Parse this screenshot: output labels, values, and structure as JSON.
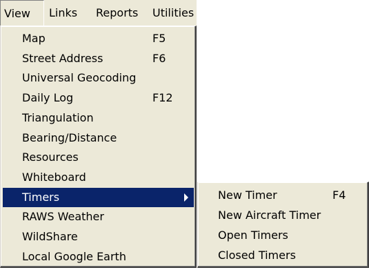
{
  "menubar": {
    "items": [
      "View",
      "Links",
      "Reports",
      "Utilities"
    ]
  },
  "view_menu": {
    "items": [
      {
        "label": "Map",
        "shortcut": "F5"
      },
      {
        "label": "Street Address",
        "shortcut": "F6"
      },
      {
        "label": "Universal Geocoding",
        "shortcut": ""
      },
      {
        "label": "Daily Log",
        "shortcut": "F12"
      },
      {
        "label": "Triangulation",
        "shortcut": ""
      },
      {
        "label": "Bearing/Distance",
        "shortcut": ""
      },
      {
        "label": "Resources",
        "shortcut": ""
      },
      {
        "label": "Whiteboard",
        "shortcut": ""
      },
      {
        "label": "Timers",
        "shortcut": ""
      },
      {
        "label": "RAWS Weather",
        "shortcut": ""
      },
      {
        "label": "WildShare",
        "shortcut": ""
      },
      {
        "label": "Local Google Earth",
        "shortcut": ""
      }
    ],
    "highlighted": "Timers"
  },
  "timers_submenu": {
    "items": [
      {
        "label": "New Timer",
        "shortcut": "F4"
      },
      {
        "label": "New Aircraft Timer",
        "shortcut": ""
      },
      {
        "label": "Open Timers",
        "shortcut": ""
      },
      {
        "label": "Closed Timers",
        "shortcut": ""
      }
    ]
  },
  "icons": {
    "timers_submenu_arrow": "chevron-right-icon"
  },
  "colors": {
    "menu_background": "#ece9d8",
    "selection_background": "#0a246a",
    "selection_text": "#ffffff"
  }
}
